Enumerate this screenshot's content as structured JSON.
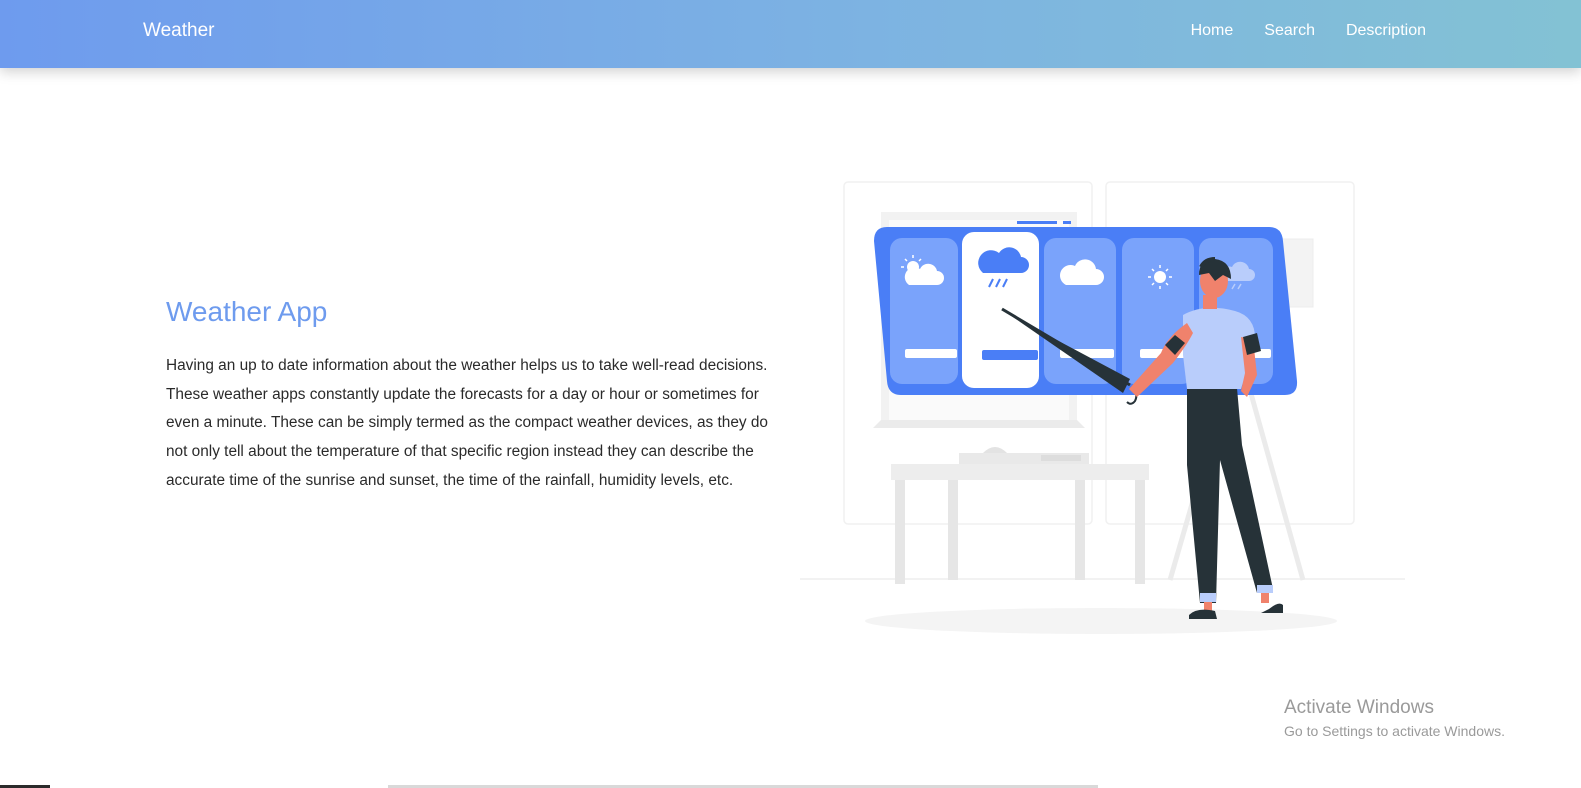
{
  "navbar": {
    "brand": "Weather",
    "links": [
      "Home",
      "Search",
      "Description"
    ]
  },
  "hero": {
    "title": "Weather App",
    "description": "Having an up to date information about the weather helps us to take well-read decisions. These weather apps constantly update the forecasts for a day or hour or sometimes for even a minute. These can be simply termed as the compact weather devices, as they do not only tell about the temperature of that specific region instead they can describe the accurate time of the sunrise and sunset, the time of the rainfall, humidity levels, etc."
  },
  "illustration": {
    "icons": [
      "partly-cloudy-icon",
      "rain-icon",
      "cloud-icon",
      "sun-icon",
      "cloudy-icon"
    ]
  },
  "watermark": {
    "title": "Activate Windows",
    "subtitle": "Go to Settings to activate Windows."
  },
  "colors": {
    "accent": "#6e9bee",
    "panel_blue": "#4a7ef6",
    "card_blue": "#7aa3fb",
    "shirt": "#b9cdfb",
    "skin": "#f0826c",
    "dark": "#263238"
  }
}
